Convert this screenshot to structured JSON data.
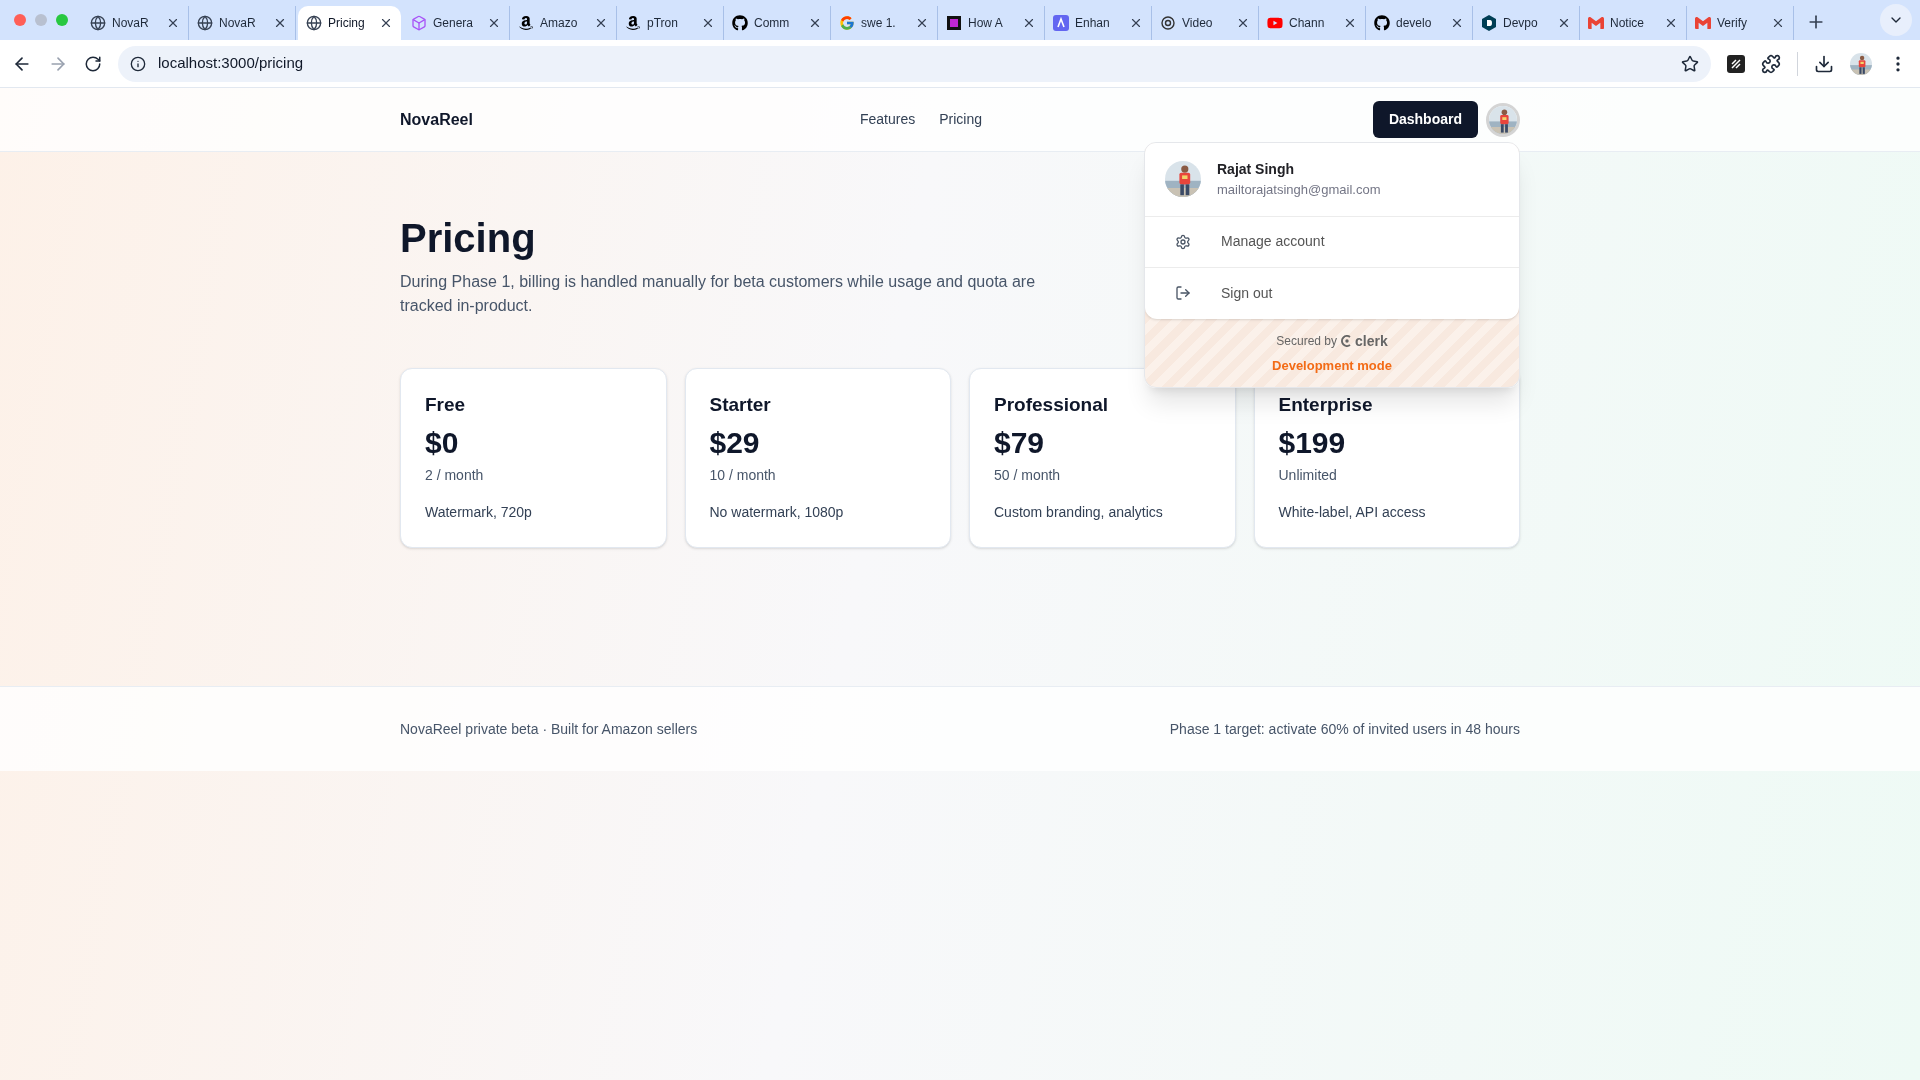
{
  "browser": {
    "tabs": [
      {
        "title": "NovaR",
        "kind": "globe",
        "selected": false
      },
      {
        "title": "NovaR",
        "kind": "globe",
        "selected": false
      },
      {
        "title": "Pricing",
        "kind": "globe",
        "selected": true
      },
      {
        "title": "Genera",
        "kind": "cube",
        "selected": false
      },
      {
        "title": "Amazo",
        "kind": "amazon",
        "selected": false
      },
      {
        "title": "pTron",
        "kind": "amazon",
        "selected": false
      },
      {
        "title": "Comm",
        "kind": "github",
        "selected": false
      },
      {
        "title": "swe 1.",
        "kind": "google",
        "selected": false
      },
      {
        "title": "How A",
        "kind": "film",
        "selected": false
      },
      {
        "title": "Enhan",
        "kind": "enhance",
        "selected": false
      },
      {
        "title": "Video",
        "kind": "knot",
        "selected": false
      },
      {
        "title": "Chann",
        "kind": "youtube",
        "selected": false
      },
      {
        "title": "develo",
        "kind": "github",
        "selected": false
      },
      {
        "title": "Devpo",
        "kind": "devpost",
        "selected": false
      },
      {
        "title": "Notice",
        "kind": "gmail",
        "selected": false
      },
      {
        "title": "Verify",
        "kind": "gmail",
        "selected": false
      }
    ],
    "address": "localhost:3000/pricing"
  },
  "header": {
    "brand": "NovaReel",
    "nav": [
      "Features",
      "Pricing"
    ],
    "dashboard_button": "Dashboard"
  },
  "hero": {
    "title": "Pricing",
    "description": "During Phase 1, billing is handled manually for beta customers while usage and quota are tracked in-product."
  },
  "plans": [
    {
      "name": "Free",
      "price": "$0",
      "quota": "2 / month",
      "features": "Watermark, 720p"
    },
    {
      "name": "Starter",
      "price": "$29",
      "quota": "10 / month",
      "features": "No watermark, 1080p"
    },
    {
      "name": "Professional",
      "price": "$79",
      "quota": "50 / month",
      "features": "Custom branding, analytics"
    },
    {
      "name": "Enterprise",
      "price": "$199",
      "quota": "Unlimited",
      "features": "White-label, API access"
    }
  ],
  "footer": {
    "left": "NovaReel private beta · Built for Amazon sellers",
    "right": "Phase 1 target: activate 60% of invited users in 48 hours"
  },
  "user_menu": {
    "name": "Rajat Singh",
    "email": "mailtorajatsingh@gmail.com",
    "items": [
      {
        "label": "Manage account",
        "kind": "settings"
      },
      {
        "label": "Sign out",
        "kind": "sign_out"
      }
    ],
    "secured_by": "Secured by",
    "provider": "clerk",
    "mode": "Development mode"
  }
}
